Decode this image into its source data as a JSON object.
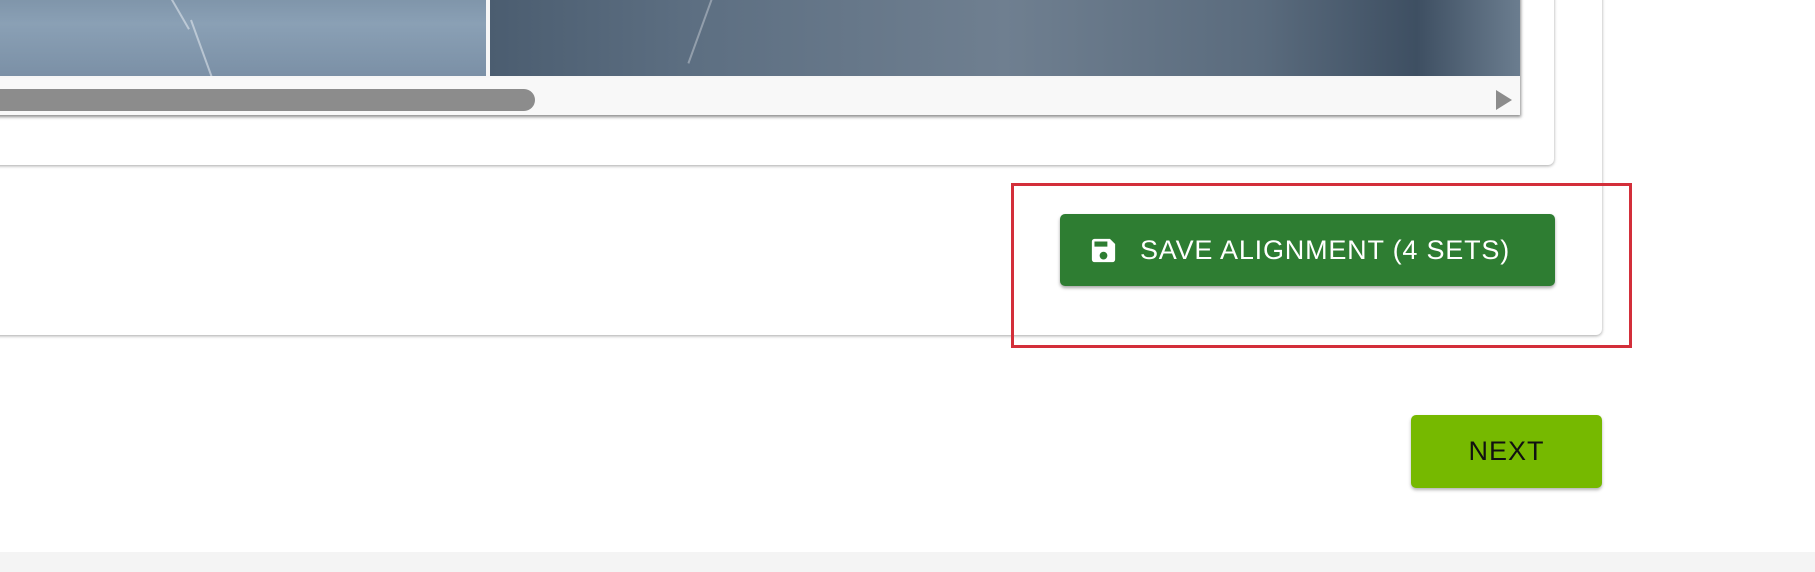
{
  "viewer": {
    "images": [
      {
        "name": "image-left",
        "description_hidden": ""
      },
      {
        "name": "image-right",
        "description_hidden": ""
      }
    ],
    "scroll_position_fraction": 0.37
  },
  "actions": {
    "save_label": "SAVE ALIGNMENT (4 SETS)",
    "save_icon": "floppy-disk-icon",
    "save_color": "#2e7d32",
    "next_label": "NEXT",
    "next_color": "#76b900"
  },
  "highlight": {
    "color": "#d32f3a"
  }
}
